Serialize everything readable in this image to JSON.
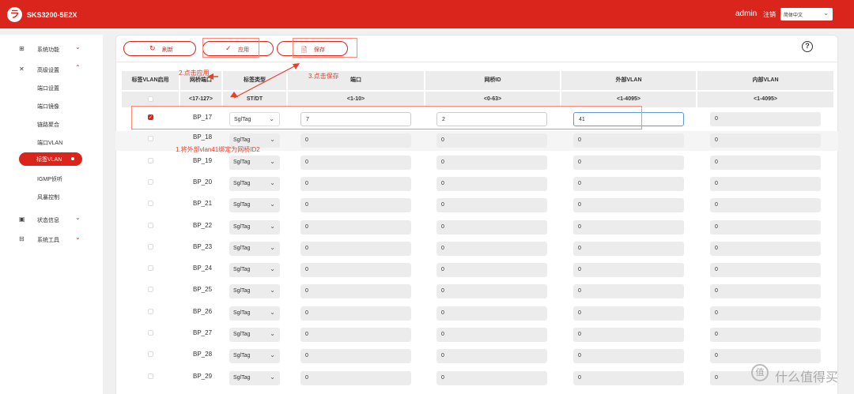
{
  "header": {
    "logo_glyph": "ラ",
    "model": "SKS3200-5E2X",
    "user": "admin",
    "logout": "注销",
    "language": "简体中文"
  },
  "sidebar": {
    "items": [
      {
        "label": "系统功能",
        "icon": "grid-icon",
        "glyph": "⊞"
      },
      {
        "label": "高级设置",
        "icon": "tools-icon",
        "glyph": "✕"
      },
      {
        "label": "端口设置"
      },
      {
        "label": "端口镜像"
      },
      {
        "label": "链路聚合"
      },
      {
        "label": "端口VLAN"
      },
      {
        "label": "标签VLAN"
      },
      {
        "label": "IGMP侦听"
      },
      {
        "label": "风暴控制"
      },
      {
        "label": "状态信息",
        "icon": "monitor-icon",
        "glyph": "▣"
      },
      {
        "label": "系统工具",
        "icon": "toolbox-icon",
        "glyph": "⊟"
      }
    ]
  },
  "toolbar": {
    "refresh": "刷新",
    "apply": "应用",
    "save": "保存",
    "help": "?"
  },
  "table": {
    "headers": [
      "标签VLAN启用",
      "网桥端口",
      "标签类型",
      "端口",
      "网桥ID",
      "外部VLAN",
      "内部VLAN"
    ],
    "ranges": [
      "<17-127>",
      "ST/DT",
      "<1-10>",
      "<0-63>",
      "<1-4095>",
      "<1-4095>"
    ],
    "rows": [
      {
        "port": "BP_17",
        "tag": "SglTag",
        "port_no": "7",
        "bridge_id": "2",
        "outer_vlan": "41",
        "inner_vlan": "0",
        "checked": true
      },
      {
        "port": "BP_18",
        "tag": "SglTag",
        "port_no": "0",
        "bridge_id": "0",
        "outer_vlan": "0",
        "inner_vlan": "0",
        "checked": false
      },
      {
        "port": "BP_19",
        "tag": "SglTag",
        "port_no": "0",
        "bridge_id": "0",
        "outer_vlan": "0",
        "inner_vlan": "0",
        "checked": false
      },
      {
        "port": "BP_20",
        "tag": "SglTag",
        "port_no": "0",
        "bridge_id": "0",
        "outer_vlan": "0",
        "inner_vlan": "0",
        "checked": false
      },
      {
        "port": "BP_21",
        "tag": "SglTag",
        "port_no": "0",
        "bridge_id": "0",
        "outer_vlan": "0",
        "inner_vlan": "0",
        "checked": false
      },
      {
        "port": "BP_22",
        "tag": "SglTag",
        "port_no": "0",
        "bridge_id": "0",
        "outer_vlan": "0",
        "inner_vlan": "0",
        "checked": false
      },
      {
        "port": "BP_23",
        "tag": "SglTag",
        "port_no": "0",
        "bridge_id": "0",
        "outer_vlan": "0",
        "inner_vlan": "0",
        "checked": false
      },
      {
        "port": "BP_24",
        "tag": "SglTag",
        "port_no": "0",
        "bridge_id": "0",
        "outer_vlan": "0",
        "inner_vlan": "0",
        "checked": false
      },
      {
        "port": "BP_25",
        "tag": "SglTag",
        "port_no": "0",
        "bridge_id": "0",
        "outer_vlan": "0",
        "inner_vlan": "0",
        "checked": false
      },
      {
        "port": "BP_26",
        "tag": "SglTag",
        "port_no": "0",
        "bridge_id": "0",
        "outer_vlan": "0",
        "inner_vlan": "0",
        "checked": false
      },
      {
        "port": "BP_27",
        "tag": "SglTag",
        "port_no": "0",
        "bridge_id": "0",
        "outer_vlan": "0",
        "inner_vlan": "0",
        "checked": false
      },
      {
        "port": "BP_28",
        "tag": "SglTag",
        "port_no": "0",
        "bridge_id": "0",
        "outer_vlan": "0",
        "inner_vlan": "0",
        "checked": false
      },
      {
        "port": "BP_29",
        "tag": "SglTag",
        "port_no": "0",
        "bridge_id": "0",
        "outer_vlan": "0",
        "inner_vlan": "0",
        "checked": false
      }
    ]
  },
  "annotations": {
    "step1": "1.将外部vlan41绑定为网桥ID2",
    "step2": "2.点击应用",
    "step3": "3.点击保存"
  },
  "watermark": {
    "logo": "值",
    "text": "什么值得买"
  },
  "colors": {
    "brand": "#d9251c",
    "annotation": "#e8412a"
  }
}
